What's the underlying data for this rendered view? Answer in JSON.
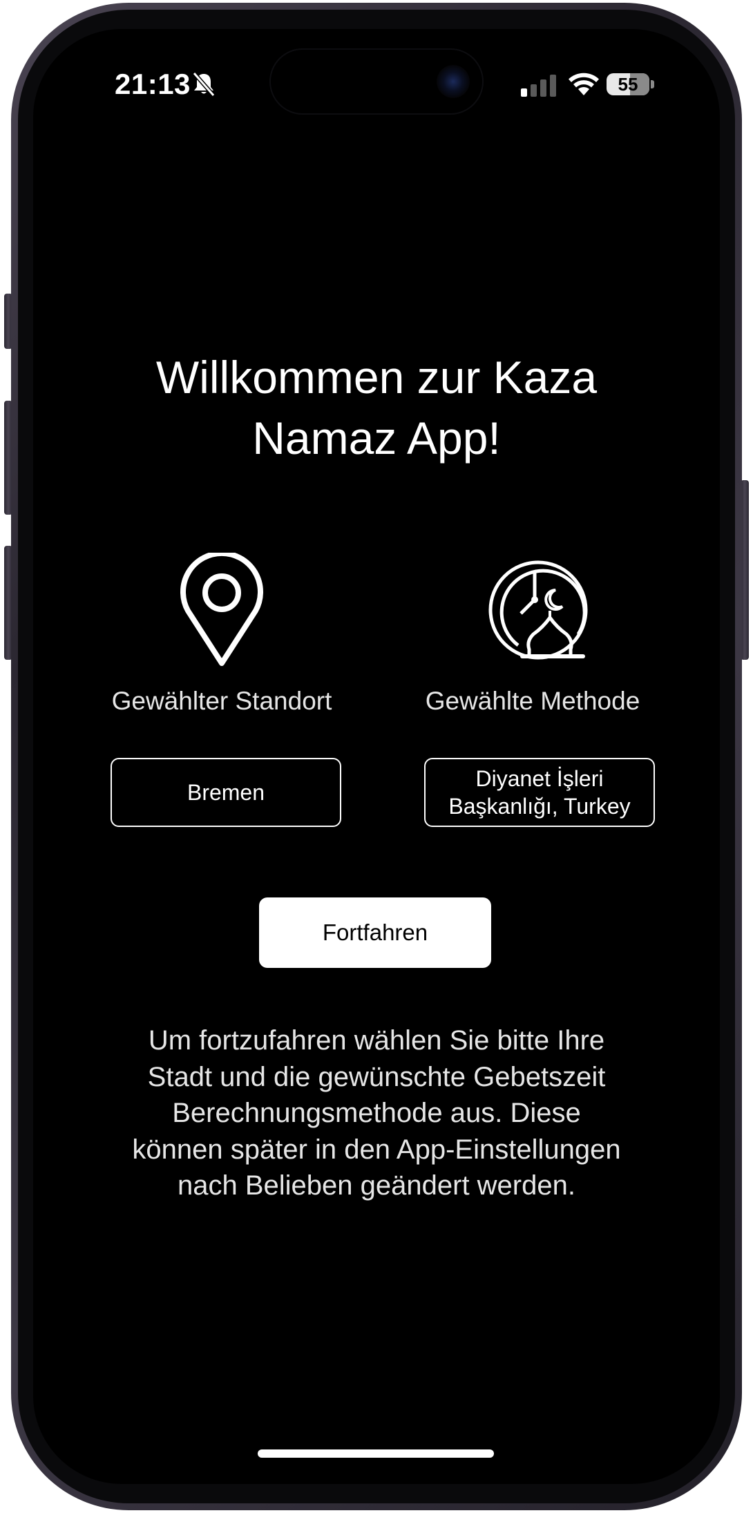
{
  "status_bar": {
    "time": "21:13",
    "silent_icon": "bell-slash-icon",
    "signal_icon": "cellular-signal-icon",
    "wifi_icon": "wifi-icon",
    "battery_level": "55"
  },
  "welcome": {
    "title": "Willkommen zur Kaza Namaz App!"
  },
  "location": {
    "icon": "location-pin-icon",
    "label": "Gewählter Standort",
    "value": "Bremen"
  },
  "method": {
    "icon": "mosque-clock-icon",
    "label": "Gewählte Methode",
    "value": "Diyanet İşleri Başkanlığı, Turkey"
  },
  "actions": {
    "continue_label": "Fortfahren"
  },
  "info": {
    "text": "Um fortzufahren wählen Sie bitte Ihre Stadt und die gewünschte Gebetszeit Berechnungsmethode aus. Diese können später in den App-Einstellungen nach Belieben geändert werden."
  },
  "colors": {
    "background": "#000000",
    "foreground": "#ffffff",
    "button_background": "#ffffff",
    "button_text": "#000000"
  }
}
